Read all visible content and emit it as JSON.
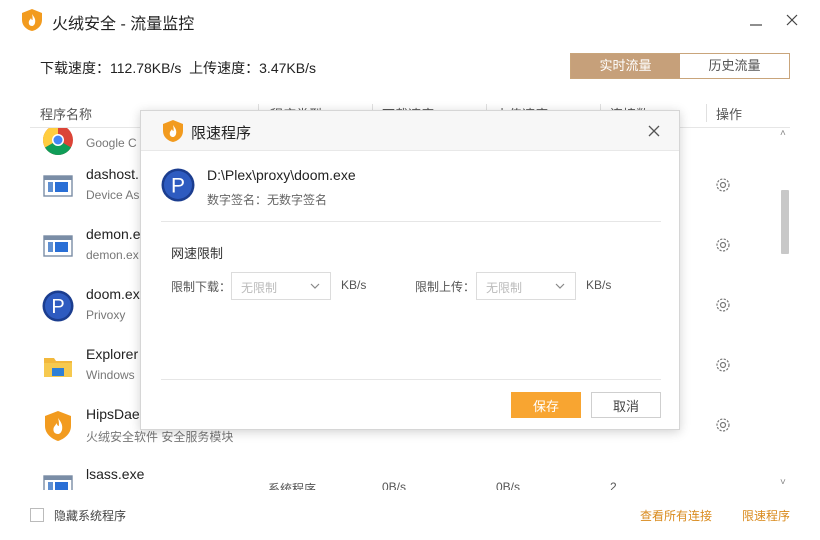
{
  "window": {
    "title": "火绒安全 - 流量监控",
    "icon": "huorong-shield-logo",
    "minimize_icon": "minimize-icon",
    "close_icon": "close-icon"
  },
  "speed": {
    "download_label": "下载速度：",
    "download_value": "112.78KB/s",
    "upload_label": "上传速度：",
    "upload_value": "3.47KB/s"
  },
  "tabs": {
    "realtime": "实时流量",
    "history": "历史流量",
    "active": "realtime"
  },
  "table": {
    "columns": [
      "程序名称",
      "程序类型",
      "下载速度",
      "上传速度",
      "连接数",
      "操作"
    ],
    "rows": [
      {
        "name": "Google C",
        "desc": "",
        "icon": "chrome-icon",
        "type": "",
        "down": "",
        "up": "",
        "conn": ""
      },
      {
        "name": "dashost.",
        "desc": "Device As",
        "icon": "window-app-icon",
        "type": "",
        "down": "",
        "up": "",
        "conn": ""
      },
      {
        "name": "demon.e",
        "desc": "demon.ex",
        "icon": "window-app-icon",
        "type": "",
        "down": "",
        "up": "",
        "conn": ""
      },
      {
        "name": "doom.ex",
        "desc": "Privoxy",
        "icon": "privoxy-icon",
        "type": "",
        "down": "",
        "up": "",
        "conn": ""
      },
      {
        "name": "Explorer",
        "desc": "Windows",
        "icon": "folder-icon",
        "type": "",
        "down": "",
        "up": "",
        "conn": ""
      },
      {
        "name": "HipsDae",
        "desc": "火绒安全软件 安全服务模块",
        "icon": "huorong-shield-icon",
        "type": "",
        "down": "",
        "up": "",
        "conn": ""
      },
      {
        "name": "lsass.exe",
        "desc": "",
        "icon": "window-app-icon",
        "type": "系统程序",
        "down": "0B/s",
        "up": "0B/s",
        "conn": "2"
      }
    ]
  },
  "footer": {
    "hide_system_label": "隐藏系统程序",
    "view_connections": "查看所有连接",
    "speed_limit": "限速程序"
  },
  "modal": {
    "title": "限速程序",
    "path": "D:\\Plex\\proxy\\doom.exe",
    "signature": "数字签名：无数字签名",
    "section_title": "网速限制",
    "download_limit_label": "限制下载：",
    "download_limit_value": "无限制",
    "upload_limit_label": "限制上传：",
    "upload_limit_value": "无限制",
    "unit": "KB/s",
    "save": "保存",
    "cancel": "取消"
  },
  "colors": {
    "accent": "#f8a531",
    "tab_active": "#c6a07a",
    "link": "#d98a1c"
  }
}
